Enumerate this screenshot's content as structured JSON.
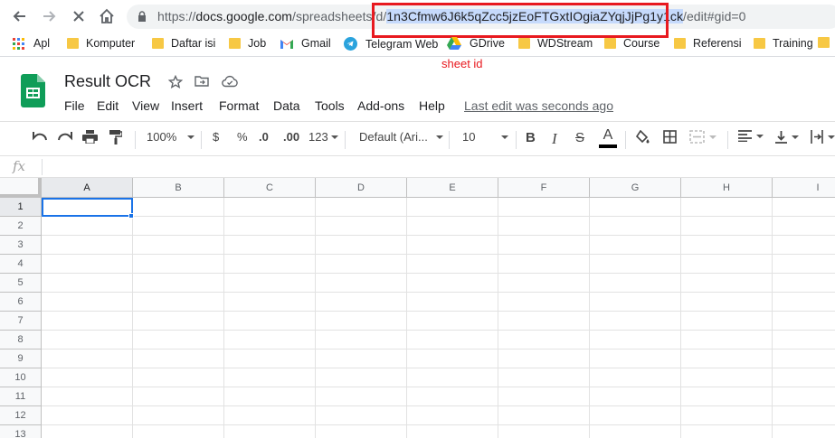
{
  "browser": {
    "url_prefix": "https://",
    "url_host": "docs.google.com",
    "url_path": "/spreadsheets/d/",
    "url_selected": "1n3Cfmw6J6k5qZcc5jzEoFTGxtIOgiaZYqjJjPg1y1ck",
    "url_suffix": "/edit#gid=0",
    "annotation": "sheet id"
  },
  "bookmarks": [
    {
      "label": "Apl",
      "icon": "apps-grid-icon"
    },
    {
      "label": "Komputer",
      "icon": "folder-icon"
    },
    {
      "label": "Daftar isi",
      "icon": "folder-icon"
    },
    {
      "label": "Job",
      "icon": "folder-icon"
    },
    {
      "label": "Gmail",
      "icon": "gmail-icon"
    },
    {
      "label": "Telegram Web",
      "icon": "telegram-icon"
    },
    {
      "label": "GDrive",
      "icon": "gdrive-icon"
    },
    {
      "label": "WDStream",
      "icon": "folder-icon"
    },
    {
      "label": "Course",
      "icon": "folder-icon"
    },
    {
      "label": "Referensi",
      "icon": "folder-icon"
    },
    {
      "label": "Training",
      "icon": "folder-icon"
    }
  ],
  "sheets": {
    "title": "Result OCR",
    "menu": [
      "File",
      "Edit",
      "View",
      "Insert",
      "Format",
      "Data",
      "Tools",
      "Add-ons",
      "Help"
    ],
    "last_edit": "Last edit was seconds ago"
  },
  "toolbar": {
    "zoom": "100%",
    "currency": "$",
    "percent": "%",
    "dec_decrease": ".0",
    "dec_increase": ".00",
    "more_formats": "123",
    "font": "Default (Ari...",
    "font_size": "10",
    "bold": "B",
    "italic": "I",
    "strike": "S",
    "text_color": "A"
  },
  "formula_bar": {
    "fx": "fx"
  },
  "grid": {
    "columns": [
      "A",
      "B",
      "C",
      "D",
      "E",
      "F",
      "G",
      "H",
      "I"
    ],
    "rows": [
      "1",
      "2",
      "3",
      "4",
      "5",
      "6",
      "7",
      "8",
      "9",
      "10",
      "11",
      "12",
      "13"
    ],
    "selected_cell": "A1"
  },
  "colors": {
    "accent": "#1a73e8",
    "highlight_red": "#e8191f",
    "sheets_green": "#0f9d58"
  }
}
